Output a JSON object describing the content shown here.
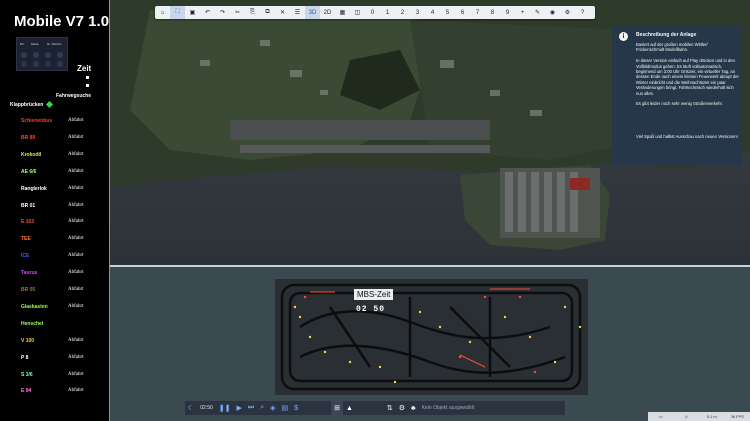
{
  "left_panel": {
    "title": "Mobile V7 1.0",
    "mini_panel_labels": [
      "EV",
      "Mode",
      "Nr. Weiche"
    ],
    "zeit_label": "Zeit",
    "fahrwegsuche_label": "Fahrwegsuche",
    "klappbruecken_label": "Klappbrücken",
    "diamond_color": "#39d353",
    "trains": [
      {
        "name": "Schienenbus",
        "color": "#ff3b2b",
        "action": "Abfahrt"
      },
      {
        "name": "BR 89",
        "color": "#ff4a2a",
        "action": "Abfahrt"
      },
      {
        "name": "Krokodil",
        "color": "#c9f05a",
        "action": "Abfahrt"
      },
      {
        "name": "AE 6/6",
        "color": "#a8ff6a",
        "action": "Abfahrt"
      },
      {
        "name": "Ranglerlok",
        "color": "#ffffff",
        "action": "Abfahrt"
      },
      {
        "name": "BR 01",
        "color": "#ffffff",
        "action": "Abfahrt"
      },
      {
        "name": "E 103",
        "color": "#ff4a3a",
        "action": "Abfahrt"
      },
      {
        "name": "TEE",
        "color": "#ff7a2a",
        "action": "Abfahrt"
      },
      {
        "name": "ICE",
        "color": "#3d5bff",
        "action": "Abfahrt"
      },
      {
        "name": "Taurus",
        "color": "#e040ff",
        "action": "Abfahrt"
      },
      {
        "name": "BR 05",
        "color": "#9a7a3a",
        "action": "Abfahrt"
      },
      {
        "name": "Glaskasten",
        "color": "#9aff4a",
        "action": "Abfahrt"
      },
      {
        "name": "Henschel",
        "color": "#9aff6a",
        "action": ""
      },
      {
        "name": "V 100",
        "color": "#ffd43a",
        "action": "Abfahrt"
      },
      {
        "name": "P 8",
        "color": "#ffffff",
        "action": "Abfahrt"
      },
      {
        "name": "S 3/6",
        "color": "#7affb0",
        "action": "Abfahrt"
      },
      {
        "name": "E 94",
        "color": "#ff7adf",
        "action": "Abfahrt"
      }
    ]
  },
  "toolbar": {
    "items": [
      {
        "id": "home",
        "glyph": "⌂",
        "active": false
      },
      {
        "id": "walk",
        "glyph": "⛶",
        "active": true
      },
      {
        "id": "save",
        "glyph": "▣",
        "active": false
      },
      {
        "id": "undo",
        "glyph": "↶",
        "active": false
      },
      {
        "id": "redo",
        "glyph": "↷",
        "active": false
      },
      {
        "id": "cut",
        "glyph": "✂",
        "active": false
      },
      {
        "id": "copy",
        "glyph": "⎘",
        "active": false
      },
      {
        "id": "paste",
        "glyph": "⧉",
        "active": false
      },
      {
        "id": "delete",
        "glyph": "✕",
        "active": false
      },
      {
        "id": "layers",
        "glyph": "☰",
        "active": false
      },
      {
        "id": "view-3d",
        "glyph": "3D",
        "active": true
      },
      {
        "id": "view-2d",
        "glyph": "2D",
        "active": false
      },
      {
        "id": "grid",
        "glyph": "▦",
        "active": false
      },
      {
        "id": "split",
        "glyph": "◫",
        "active": false
      },
      {
        "id": "n0",
        "glyph": "0",
        "active": false
      },
      {
        "id": "n1",
        "glyph": "1",
        "active": false
      },
      {
        "id": "n2",
        "glyph": "2",
        "active": false
      },
      {
        "id": "n3",
        "glyph": "3",
        "active": false
      },
      {
        "id": "n4",
        "glyph": "4",
        "active": false
      },
      {
        "id": "n5",
        "glyph": "5",
        "active": false
      },
      {
        "id": "n6",
        "glyph": "6",
        "active": false
      },
      {
        "id": "n7",
        "glyph": "7",
        "active": false
      },
      {
        "id": "n8",
        "glyph": "8",
        "active": false
      },
      {
        "id": "n9",
        "glyph": "9",
        "active": false
      },
      {
        "id": "add",
        "glyph": "+",
        "active": false
      },
      {
        "id": "edit",
        "glyph": "✎",
        "active": false
      },
      {
        "id": "camera",
        "glyph": "◉",
        "active": false
      },
      {
        "id": "settings",
        "glyph": "⚙",
        "active": false
      },
      {
        "id": "help",
        "glyph": "?",
        "active": false
      }
    ]
  },
  "info_box": {
    "title": "Beschreibung der Anlage",
    "text": "Basiert auf der großen mobilen Wittler/\nFrickenschmidt Modellbahn.\n\nIn dieser Version einfach auf Play drücken und in den Vollbildmodus gehen. Es läuft vollautomatisch, beginnend um 3:00 Uhr Ortszeit, ein virtueller Tag, an dessen Ende nach einem kleinen Feuerwerk abrupt der Winter einbricht und die Weihnachtszeit ein paar Veränderungen bringt. Fahrtechnisch wiederholt sich nun alles.\n\nEs gibt leider noch sehr wenig Straßenverkehr.\n\n\n\n\n\nViel Spaß und halbst Ausschau nach neuen Versionen!"
  },
  "mbs": {
    "label": "MBS-Zeit",
    "clock": "02 50"
  },
  "status_bar": {
    "time": "02:50",
    "object_placeholder": "Kein Objekt ausgewählt"
  },
  "fps": {
    "distance": "5.1 m",
    "fps": "38 FPS"
  }
}
